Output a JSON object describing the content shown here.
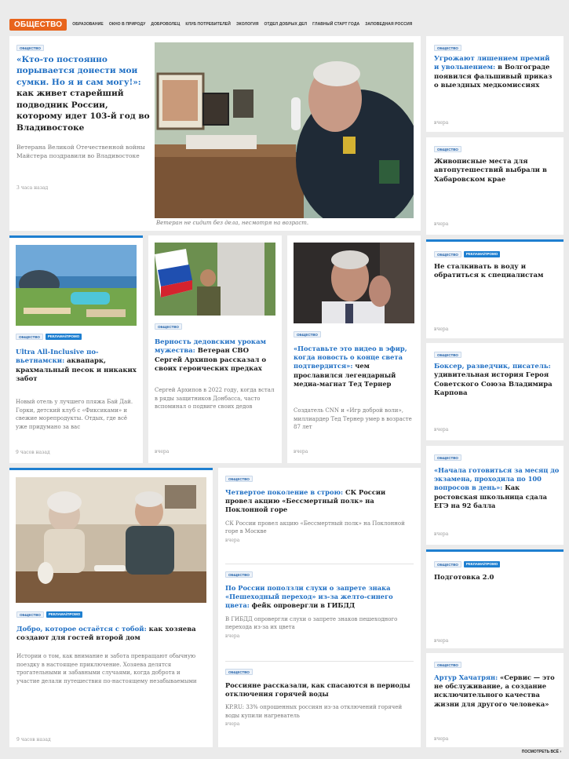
{
  "nav": {
    "section": "ОБЩЕСТВО",
    "items": [
      "ОБРАЗОВАНИЕ",
      "ОКНО В ПРИРОДУ",
      "ДОБРОВОЛЕЦ",
      "КЛУБ ПОТРЕБИТЕЛЕЙ",
      "ЭКОЛОГИЯ",
      "ОТДЕЛ ДОБРЫХ ДЕЛ",
      "ГЛАВНЫЙ СТАРТ ГОДА",
      "ЗАПОВЕДНАЯ РОССИЯ"
    ]
  },
  "tags": {
    "society": "ОБЩЕСТВО",
    "promo": "РЕКЛАМА/ПРОМО"
  },
  "main": {
    "title_accent": "«Кто-то постоянно порывается донести мои сумки. Но я и сам могу!»:",
    "title_rest": " как живет старейший подводник России, которому идет 103-й год во Владивостоке",
    "lead": "Ветерана Великой Отечественной войны Майстера поздравили во Владивостоке",
    "time": "3 часа назад",
    "caption": "Ветеран не сидит без дела, несмотря на возраст."
  },
  "side": [
    {
      "accent": "Угрожают лишением премий и увольнением:",
      "rest": " в Волгограде появился фальшивый приказ о выездных медкомиссиях",
      "time": "вчера"
    },
    {
      "accent": "",
      "rest": "Живописные места для автопутешествий выбрали в Хабаровском крае",
      "time": "вчера"
    },
    {
      "accent": "",
      "rest": "Не сталкивать в воду и обратиться к специалистам",
      "time": "вчера"
    },
    {
      "accent": "Боксер, разведчик, писатель:",
      "rest": " удивительная история Героя Советского Союза Владимира Карпова",
      "time": "вчера"
    },
    {
      "accent": "«Начала готовиться за месяц до экзамена, проходила по 100 вопросов в день»:",
      "rest": " Как ростовская школьница сдала ЕГЭ на 92 балла",
      "time": "вчера"
    },
    {
      "accent": "",
      "rest": "Подготовка 2.0",
      "time": "вчера"
    },
    {
      "accent": "Артур Хачатрян:",
      "rest": " «Сервис — это не обслуживание, а создание исключительного качества жизни для другого человека»",
      "time": "вчера"
    }
  ],
  "mid": [
    {
      "accent": "Ultra All-Inclusive по-вьетнамски:",
      "rest": " аквапарк, крахмальный песок и никаких забот",
      "lead": "Новый отель у лучшего пляжа Бай Дай. Горки, детский клуб с «Фиксиками» и свежие морепродукты. Отдых, где всё уже придумано за вас",
      "time": "9 часов назад"
    },
    {
      "accent": "Верность дедовским урокам мужества:",
      "rest": " Ветеран СВО Сергей Архипов рассказал о своих героических предках",
      "lead": "Сергей Архипов в 2022 году, когда встал в ряды защитников Донбасса, часто вспоминал о подвиге своих дедов",
      "time": "вчера"
    },
    {
      "accent": "«Поставьте это видео в эфир, когда новость о конце света подтвердится»:",
      "rest": " чем прославился легендарный медиа-магнат Тед Тернер",
      "lead": "Создатель CNN и «Игр доброй воли», миллиардер Тед Тернер умер в возрасте 87 лет",
      "time": "вчера"
    }
  ],
  "big": {
    "accent": "Добро, которое остаётся с тобой:",
    "rest": " как хозяева создают для гостей второй дом",
    "lead": "Истории о том, как внимание и забота превращают обычную поездку в настоящее приключение. Хозяева делятся трогательными и забавными случаями, когда доброта и участие делали путешествия по-настоящему незабываемыми",
    "time": "9 часов назад"
  },
  "list": [
    {
      "accent": "Четвертое поколение в строю:",
      "rest": " СК России провел акцию «Бессмертный полк» на Поклонной горе",
      "lead": "СК России провел акцию «Бессмертный полк» на Поклонной горе в Москве",
      "time": "вчера"
    },
    {
      "accent": "По России поползли слухи о запрете знака «Пешеходный переход» из-за желто-синего цвета:",
      "rest": " фейк опровергли в ГИБДД",
      "lead": "В ГИБДД опровергли слухи о запрете знаков пешеходного перехода из-за их цвета",
      "time": "вчера"
    },
    {
      "accent": "",
      "rest": "Россияне рассказали, как спасаются в периоды отключения горячей воды",
      "lead": "KP.RU: 33% опрошенных россиян из-за отключений горячей воды купили нагреватель",
      "time": "вчера"
    }
  ],
  "more": "ПОСМОТРЕТЬ ВСЁ ›"
}
